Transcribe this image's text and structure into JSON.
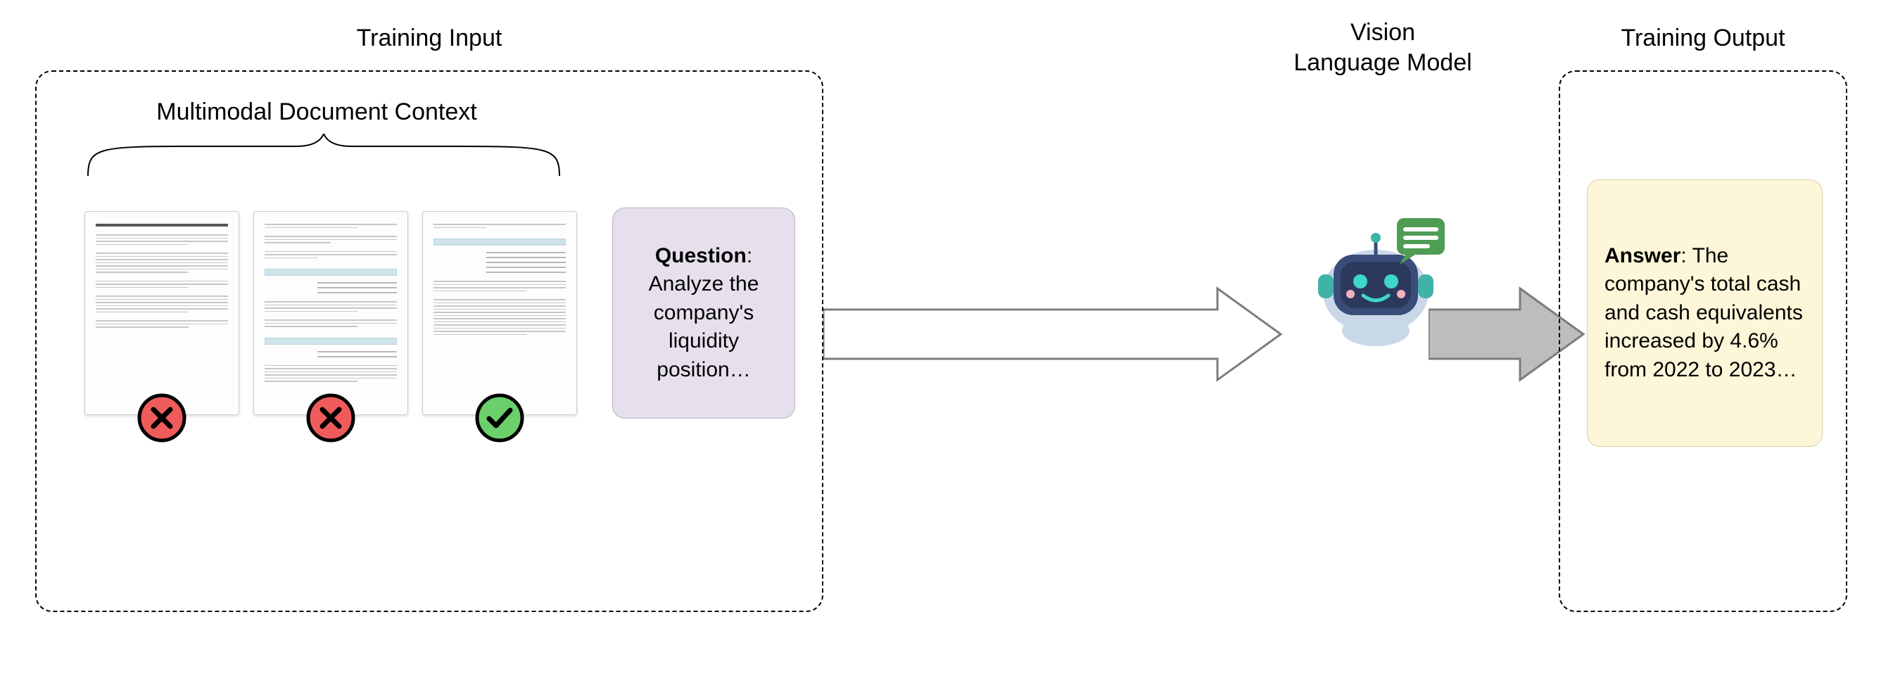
{
  "labels": {
    "training_input": "Training Input",
    "multimodal_context": "Multimodal Document Context",
    "vision_language_model": "Vision\nLanguage Model",
    "training_output": "Training Output"
  },
  "question": {
    "label": "Question",
    "body": ": Analyze the company's liquidity position…"
  },
  "answer": {
    "label": "Answer",
    "body": ": The company's total cash and cash equivalents increased by 4.6% from 2022 to 2023…"
  },
  "documents": [
    {
      "status": "rejected"
    },
    {
      "status": "rejected"
    },
    {
      "status": "accepted"
    }
  ],
  "colors": {
    "question_bg": "#e6e0ed",
    "answer_bg": "#fdf6d8",
    "reject": "#ef5b5b",
    "accept": "#6bd06b",
    "robot_body": "#3a4d7a",
    "robot_light": "#c9d8e8",
    "robot_accent": "#3fb3a8",
    "speech": "#4f9c55"
  }
}
